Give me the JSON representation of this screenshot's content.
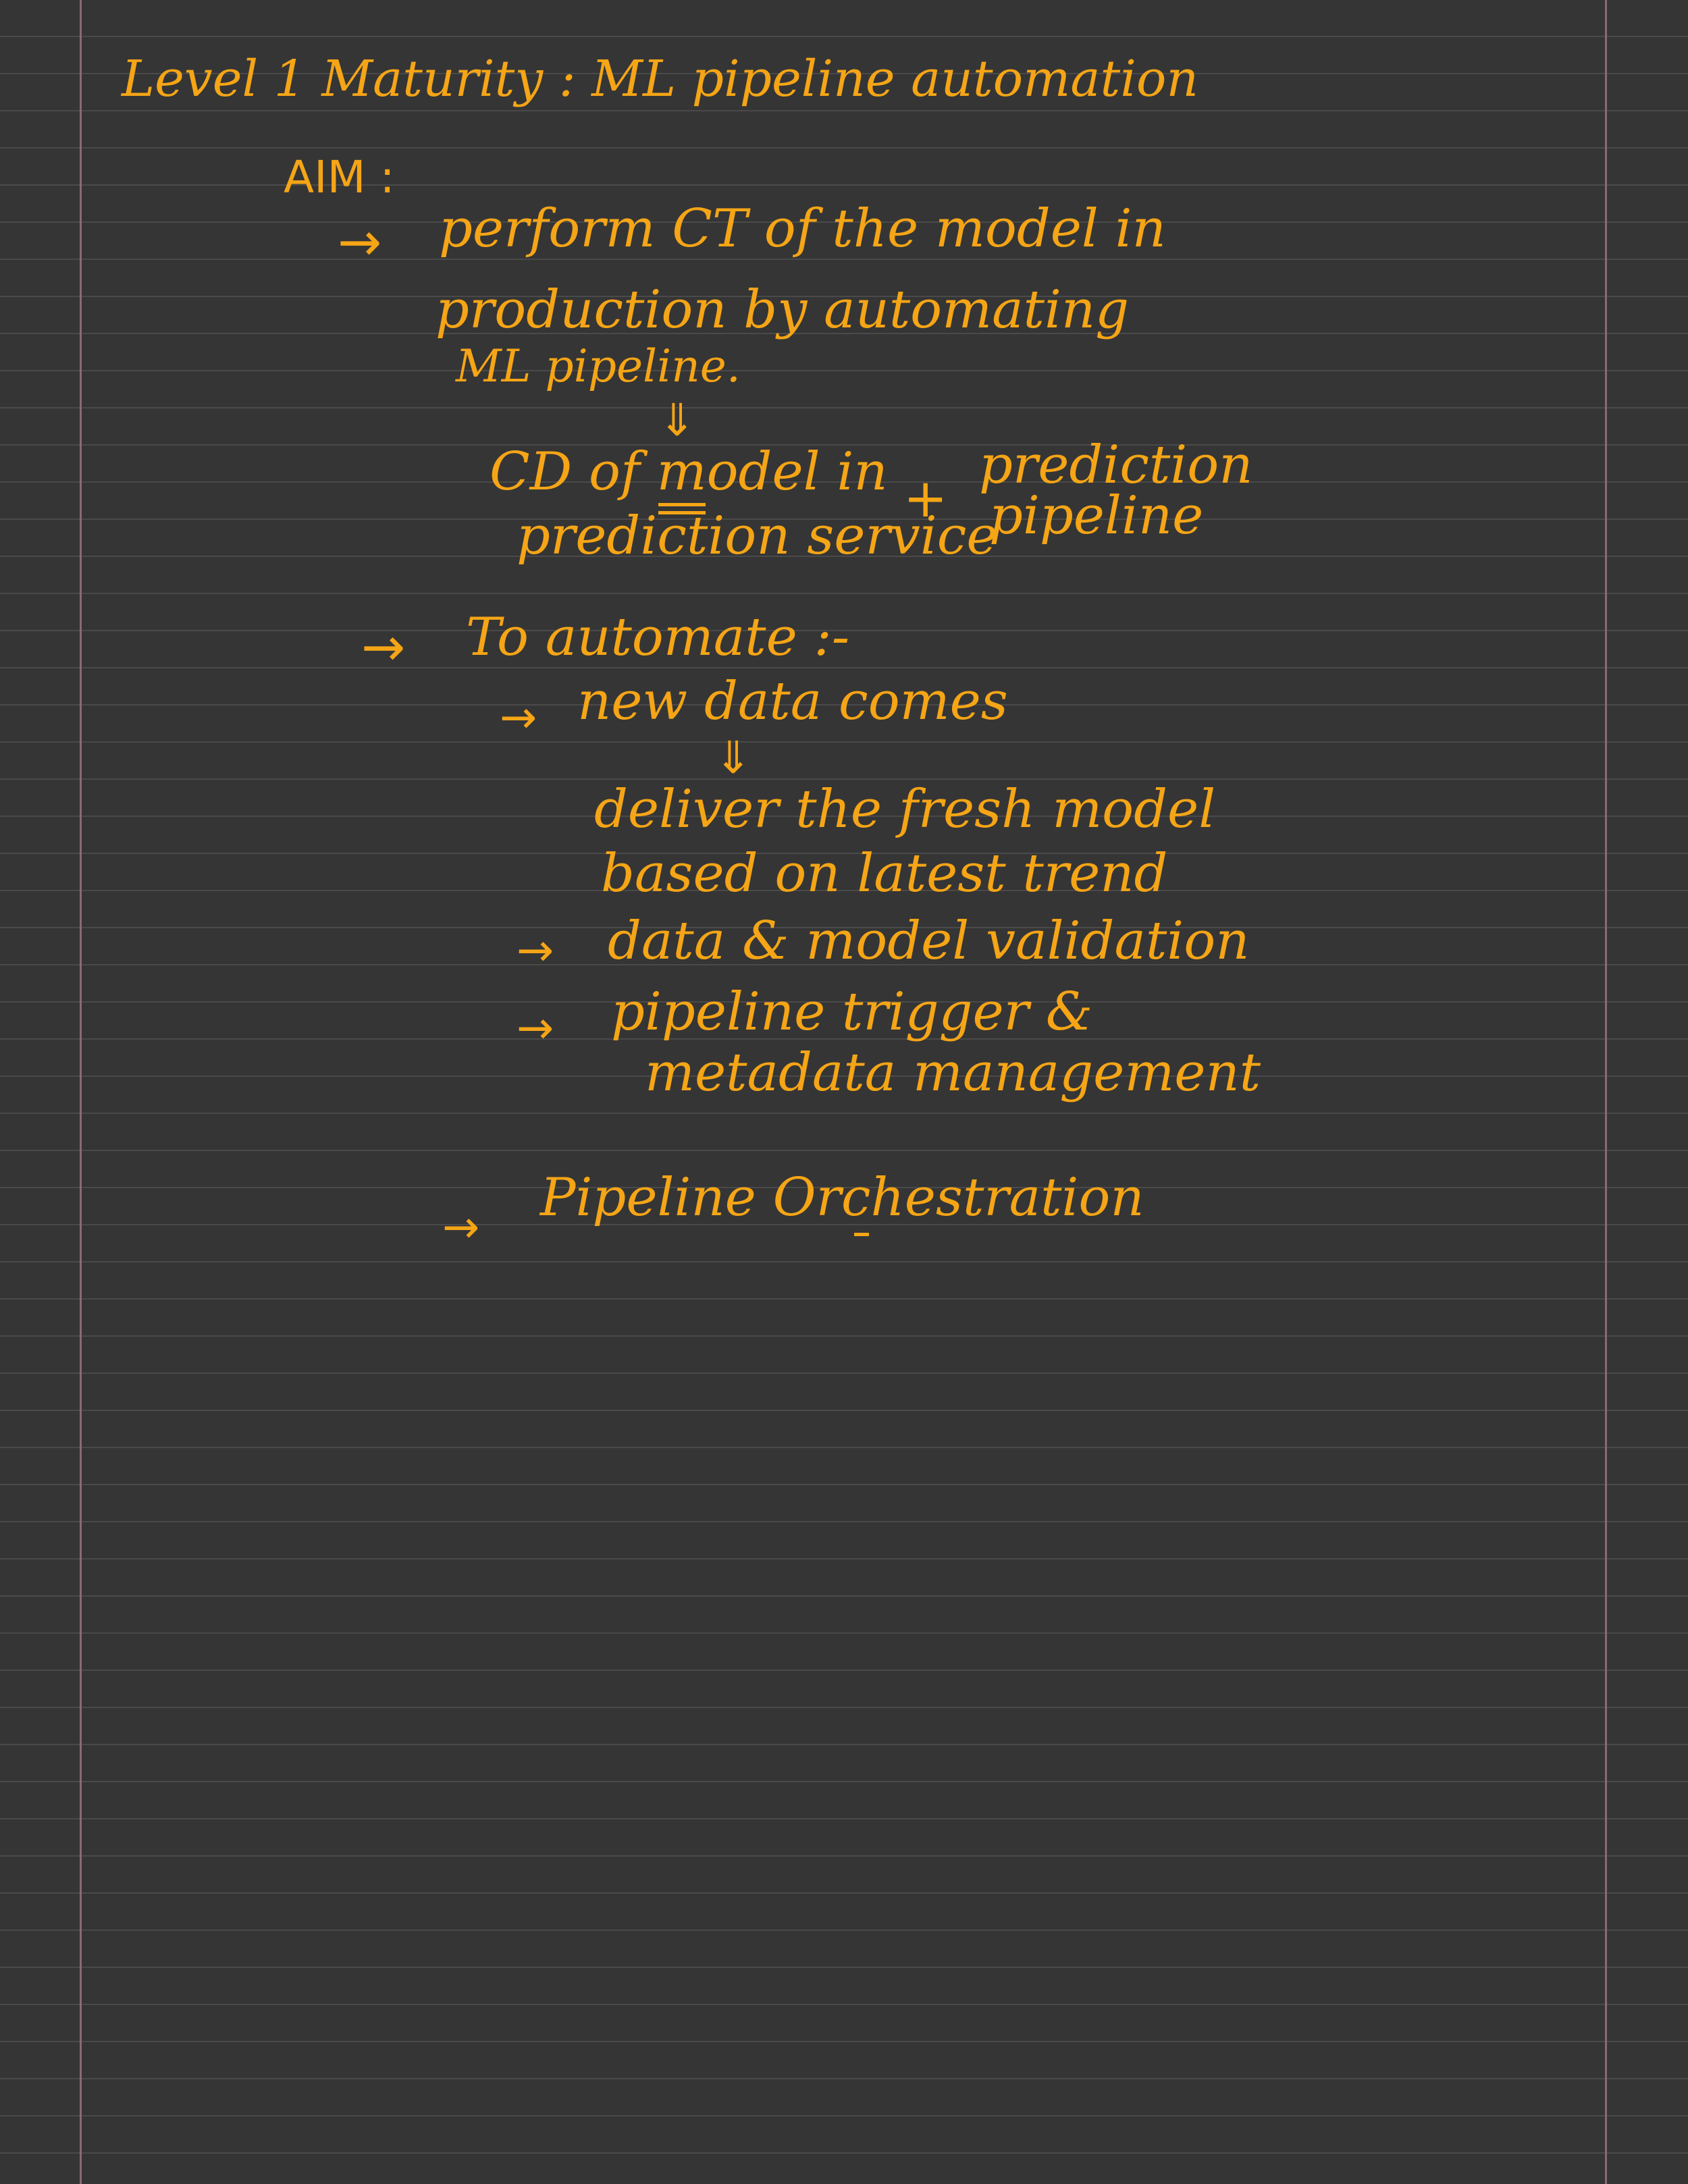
{
  "title": "Level 1 Maturity : ML pipeline automation",
  "aim_label": "AIM :",
  "symbols": {
    "right_arrow": "→",
    "down_arrow": "⇓",
    "plus": "+"
  },
  "aim": {
    "line1": "perform CT of the model in",
    "line2": "production by automating",
    "line3": "ML pipeline.",
    "cd_line1": "CD of model in",
    "cd_line2": "prediction service",
    "prediction_line1": "prediction",
    "prediction_line2": "pipeline"
  },
  "automate": {
    "heading": "To automate :-",
    "new_data": "new data comes",
    "deliver_line1": "deliver the fresh model",
    "deliver_line2": "based on latest trend",
    "validation": "data & model validation",
    "trigger_line1": "pipeline trigger &",
    "trigger_line2": "metadata management"
  },
  "orchestration": "Pipeline Orchestration",
  "colors": {
    "background": "#353535",
    "ink": "#f5a516",
    "rule_line": "#4a4a4a",
    "margin_line": "#8a6a75"
  }
}
